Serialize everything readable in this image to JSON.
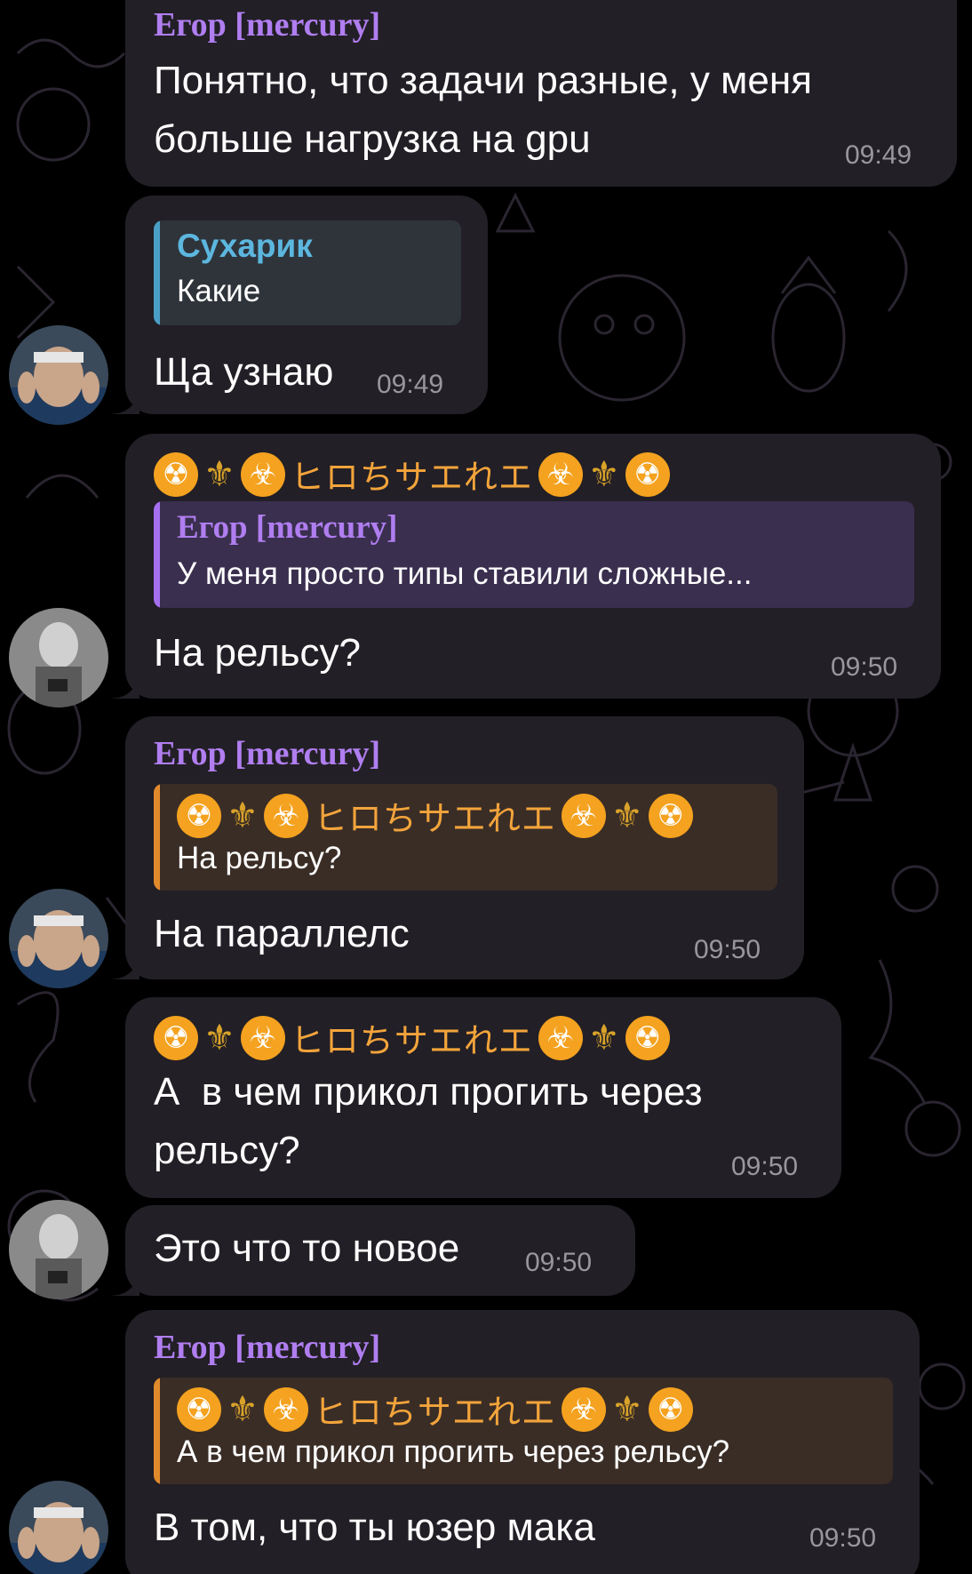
{
  "messages": [
    {
      "sender": "Егор [mercury]",
      "text_lines": [
        "Понятно, что задачи разные, у меня",
        "больше нагрузка на gpu"
      ],
      "time": "09:49"
    },
    {
      "reply": {
        "name": "Сухарик",
        "text": "Какие"
      },
      "text_lines": [
        "Ща узнаю"
      ],
      "time": "09:49"
    },
    {
      "sender_fancy": "ヒロちサエれエ",
      "reply": {
        "name": "Егор [mercury]",
        "text": "У меня просто типы ставили сложные..."
      },
      "text_lines": [
        "На рельсу?"
      ],
      "time": "09:50"
    },
    {
      "sender": "Егор [mercury]",
      "reply": {
        "name_fancy": "ヒロちサエれエ",
        "text": "На рельсу?"
      },
      "text_lines": [
        "На параллелс"
      ],
      "time": "09:50"
    },
    {
      "sender_fancy": "ヒロちサエれエ",
      "text_lines": [
        "А  в чем прикол прогить через",
        "рельсу?"
      ],
      "time": "09:50"
    },
    {
      "text_lines": [
        "Это что то новое"
      ],
      "time": "09:50"
    },
    {
      "sender": "Егор [mercury]",
      "reply": {
        "name_fancy": "ヒロちサエれエ",
        "text": "А в чем прикол прогить через рельсу?"
      },
      "text_lines": [
        "В том, что ты юзер мака"
      ],
      "time": "09:50"
    }
  ],
  "icons": {
    "radioactive": "radioactive-icon",
    "fleur": "fleur-de-lis-icon",
    "biohazard": "biohazard-icon"
  },
  "colors": {
    "background": "#000000",
    "bubble": "#221f26",
    "sender_purple": "#b07ef0",
    "reply_blue": "#4a9fc7",
    "reply_orange": "#e08a2c",
    "time_gray": "#99969d"
  }
}
